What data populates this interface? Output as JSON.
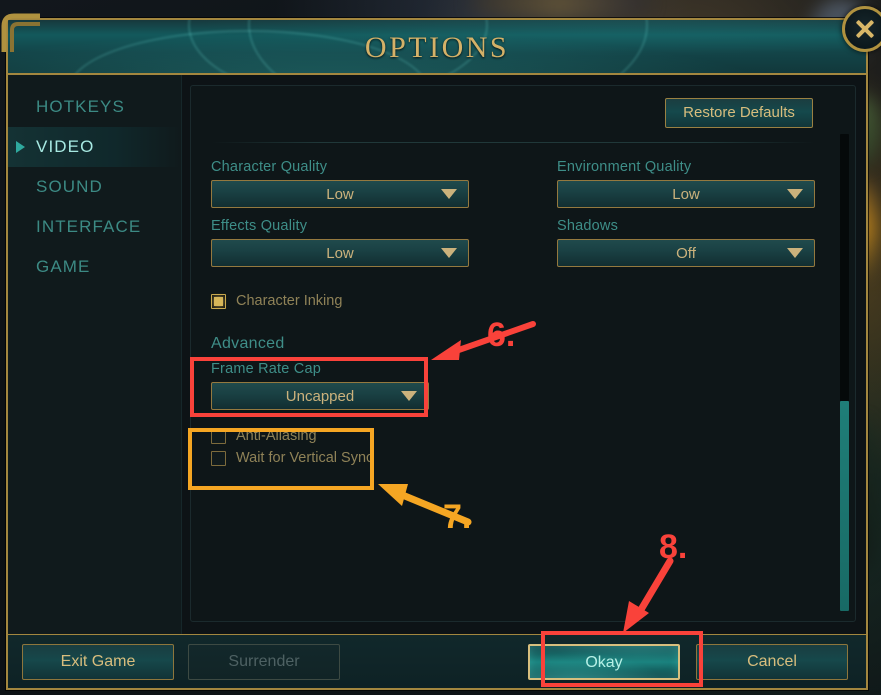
{
  "window": {
    "title": "OPTIONS",
    "close_icon": "close-x-icon"
  },
  "sidebar": {
    "items": [
      {
        "label": "HOTKEYS",
        "active": false
      },
      {
        "label": "VIDEO",
        "active": true
      },
      {
        "label": "SOUND",
        "active": false
      },
      {
        "label": "INTERFACE",
        "active": false
      },
      {
        "label": "GAME",
        "active": false
      }
    ]
  },
  "content": {
    "restore_defaults_label": "Restore Defaults",
    "fields": [
      {
        "label": "Character Quality",
        "value": "Low"
      },
      {
        "label": "Environment Quality",
        "value": "Low"
      },
      {
        "label": "Effects Quality",
        "value": "Low"
      },
      {
        "label": "Shadows",
        "value": "Off"
      }
    ],
    "character_inking": {
      "label": "Character Inking",
      "checked": true
    },
    "advanced": {
      "heading": "Advanced",
      "frame_rate_cap": {
        "label": "Frame Rate Cap",
        "value": "Uncapped"
      },
      "anti_aliasing": {
        "label": "Anti-Aliasing",
        "checked": false
      },
      "vertical_sync": {
        "label": "Wait for Vertical Sync",
        "checked": false
      }
    }
  },
  "footer": {
    "exit_game_label": "Exit Game",
    "surrender_label": "Surrender",
    "okay_label": "Okay",
    "cancel_label": "Cancel"
  },
  "annotations": {
    "step6": "6.",
    "step7": "7.",
    "step8": "8."
  },
  "colors": {
    "gold_border": "#a3873f",
    "gold_text": "#d4b168",
    "teal_label": "#3e8e88",
    "accent_teal": "#2fa99e",
    "anno_red": "#f9423a",
    "anno_yellow": "#f5a623"
  }
}
